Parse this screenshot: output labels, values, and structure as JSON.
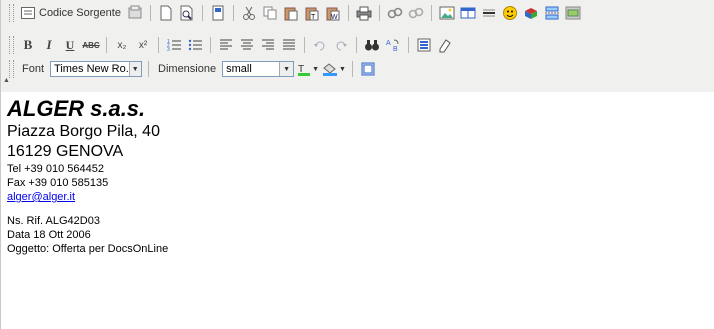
{
  "toolbar": {
    "source_label": "Codice Sorgente",
    "font_label": "Font",
    "font_value": "Times New Ro...",
    "size_label": "Dimensione",
    "size_value": "small",
    "bold_glyph": "B",
    "italic_glyph": "I",
    "underline_glyph": "U",
    "strike_glyph": "ABC",
    "subscript_glyph": "x₂",
    "superscript_glyph": "x²"
  },
  "document": {
    "company": "ALGER s.a.s.",
    "street": "Piazza Borgo Pila, 40",
    "city": "16129 GENOVA",
    "tel": "Tel +39 010 564452",
    "fax": "Fax +39 010 585135",
    "email": "alger@alger.it",
    "ref": "Ns. Rif. ALG42D03",
    "date": "Data 18 Ott 2006",
    "subject": "Oggetto: Offerta per DocsOnLine"
  },
  "colors": {
    "toolbar_bg": "#f0f0ee",
    "link": "#0000ee"
  }
}
